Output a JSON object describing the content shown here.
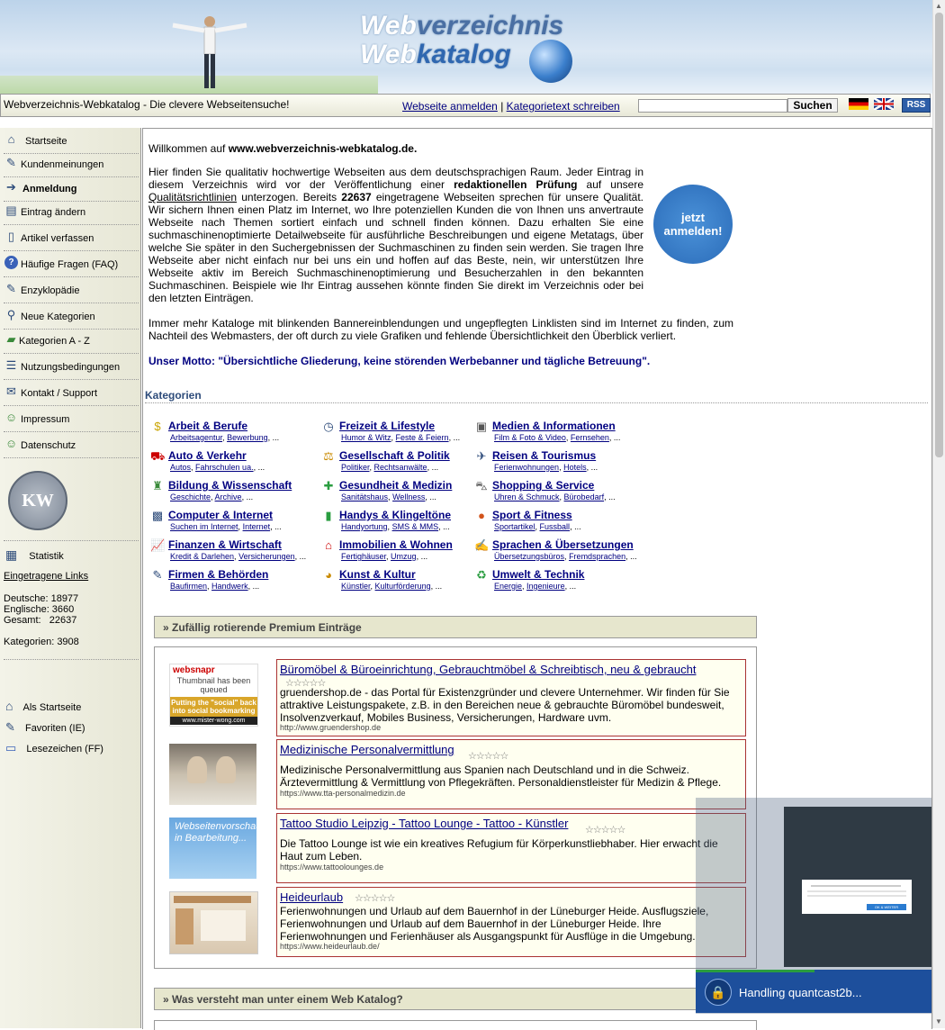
{
  "header": {
    "logo_line1_a": "Web",
    "logo_line1_b": "verzeichnis",
    "logo_line2_a": "Web",
    "logo_line2_b": "katalog"
  },
  "topbar": {
    "tagline": "Webverzeichnis-Webkatalog - Die clevere Webseitensuche!",
    "link_register": "Webseite anmelden",
    "separator": "|",
    "link_category_text": "Kategorietext schreiben",
    "search_placeholder": "",
    "search_button": "Suchen",
    "rss": "RSS"
  },
  "sidebar": {
    "items": [
      {
        "label": "Startseite",
        "icon": "home-icon"
      },
      {
        "label": "Kundenmeinungen",
        "icon": "star-note-icon"
      },
      {
        "label": "Anmeldung",
        "icon": "login-icon"
      },
      {
        "label": "Eintrag ändern",
        "icon": "edit-icon"
      },
      {
        "label": "Artikel verfassen",
        "icon": "document-icon"
      },
      {
        "label": "Häufige Fragen (FAQ)",
        "icon": "help-icon"
      },
      {
        "label": "Enzyklopädie",
        "icon": "notepad-icon"
      },
      {
        "label": "Neue Kategorien",
        "icon": "magnifier-icon"
      },
      {
        "label": "Kategorien A - Z",
        "icon": "folder-icon"
      },
      {
        "label": "Nutzungsbedingungen",
        "icon": "list-icon"
      },
      {
        "label": "Kontakt / Support",
        "icon": "mail-icon"
      },
      {
        "label": "Impressum",
        "icon": "person-icon"
      },
      {
        "label": "Datenschutz",
        "icon": "person-icon"
      }
    ],
    "statistik_label": "Statistik",
    "eingetragene_links": "Eingetragene Links",
    "stats": [
      "Deutsche: 18977",
      "Englische: 3660",
      "Gesamt:   22637",
      "Kategorien: 3908"
    ],
    "bottom": [
      {
        "label": "Als Startseite",
        "icon": "home-icon"
      },
      {
        "label": "Favoriten (IE)",
        "icon": "favorite-icon"
      },
      {
        "label": "Lesezeichen (FF)",
        "icon": "folder-icon"
      }
    ]
  },
  "main": {
    "welcome_prefix": "Willkommen auf ",
    "welcome_site": "www.webverzeichnis-webkatalog.de.",
    "intro_p1_a": "Hier finden Sie qualitativ hochwertige Webseiten aus dem deutschsprachigen Raum. Jeder Eintrag in diesem Verzeichnis wird vor der Veröffentlichung einer ",
    "intro_p1_bold": "redaktionellen Prüfung",
    "intro_p1_b": " auf unsere ",
    "intro_p1_link": "Qualitätsrichtlinien",
    "intro_p1_c": " unterzogen. Bereits ",
    "intro_p1_count": "22637",
    "intro_p1_d": " eingetragene Webseiten sprechen für unsere Qualität. Wir sichern Ihnen einen Platz im Internet, wo Ihre potenziellen Kunden die von Ihnen uns anvertraute Webseite nach Themen sortiert einfach und schnell finden können. Dazu erhalten Sie eine suchmaschinenoptimierte Detailwebseite für ausführliche Beschreibungen und eigene Metatags, über welche Sie später in den Suchergebnissen der Suchmaschinen zu finden sein werden. Sie tragen Ihre Webseite aber nicht einfach nur bei uns ein und hoffen auf das Beste, nein, wir unterstützen Ihre Webseite aktiv im Bereich Suchmaschinenoptimierung und Besucherzahlen in den bekannten Suchmaschinen. Beispiele wie Ihr Eintrag aussehen könnte finden Sie direkt im Verzeichnis oder bei den letzten Einträgen.",
    "intro_p2": "Immer mehr Kataloge mit blinkenden Bannereinblendungen und ungepflegten Linklisten sind im Internet zu finden, zum Nachteil des Webmasters, der oft durch zu viele Grafiken und fehlende Übersichtlichkeit den Überblick verliert.",
    "motto": "Unser Motto: \"Übersichtliche Gliederung, keine störenden Werbebanner und tägliche Betreuung\".",
    "signup_badge_1": "jetzt",
    "signup_badge_2": "anmelden!",
    "categories_heading": "Kategorien",
    "categories": [
      {
        "name": "Arbeit & Berufe",
        "subs": [
          "Arbeitsagentur",
          "Bewerbung"
        ],
        "icon": "money-icon"
      },
      {
        "name": "Freizeit & Lifestyle",
        "subs": [
          "Humor & Witz",
          "Feste & Feiern"
        ],
        "icon": "clock-icon"
      },
      {
        "name": "Medien & Informationen",
        "subs": [
          "Film & Foto & Video",
          "Fernsehen"
        ],
        "icon": "media-icon"
      },
      {
        "name": "Auto & Verkehr",
        "subs": [
          "Autos",
          "Fahrschulen ua."
        ],
        "icon": "car-icon"
      },
      {
        "name": "Gesellschaft & Politik",
        "subs": [
          "Politiker",
          "Rechtsanwälte"
        ],
        "icon": "scales-icon"
      },
      {
        "name": "Reisen & Tourismus",
        "subs": [
          "Ferienwohnungen",
          "Hotels"
        ],
        "icon": "airplane-icon"
      },
      {
        "name": "Bildung & Wissenschaft",
        "subs": [
          "Geschichte",
          "Archive"
        ],
        "icon": "graduation-icon"
      },
      {
        "name": "Gesundheit & Medizin",
        "subs": [
          "Sanitätshaus",
          "Wellness"
        ],
        "icon": "medical-cross-icon"
      },
      {
        "name": "Shopping & Service",
        "subs": [
          "Uhren & Schmuck",
          "Bürobedarf"
        ],
        "icon": "cart-icon"
      },
      {
        "name": "Computer & Internet",
        "subs": [
          "Suchen im Internet",
          "Internet"
        ],
        "icon": "computer-icon"
      },
      {
        "name": "Handys & Klingeltöne",
        "subs": [
          "Handyortung",
          "SMS & MMS"
        ],
        "icon": "phone-icon"
      },
      {
        "name": "Sport & Fitness",
        "subs": [
          "Sportartikel",
          "Fussball"
        ],
        "icon": "ball-icon"
      },
      {
        "name": "Finanzen & Wirtschaft",
        "subs": [
          "Kredit & Darlehen",
          "Versicherungen"
        ],
        "icon": "chart-icon"
      },
      {
        "name": "Immobilien & Wohnen",
        "subs": [
          "Fertighäuser",
          "Umzug"
        ],
        "icon": "house-icon"
      },
      {
        "name": "Sprachen & Übersetzungen",
        "subs": [
          "Übersetzungsbüros",
          "Fremdsprachen"
        ],
        "icon": "language-icon"
      },
      {
        "name": "Firmen & Behörden",
        "subs": [
          "Baufirmen",
          "Handwerk"
        ],
        "icon": "pencil-icon"
      },
      {
        "name": "Kunst & Kultur",
        "subs": [
          "Künstler",
          "Kulturförderung"
        ],
        "icon": "palette-icon"
      },
      {
        "name": "Umwelt & Technik",
        "subs": [
          "Energie",
          "Ingenieure"
        ],
        "icon": "recycle-icon"
      }
    ],
    "premium_heading": "» Zufällig rotierende Premium Einträge",
    "entries": [
      {
        "title": "Büromöbel & Büroeinrichtung, Gebrauchtmöbel & Schreibtisch, neu & gebraucht",
        "stars": "☆☆☆☆☆",
        "desc": "gruendershop.de - das Portal für Existenzgründer und clevere Unternehmer. Wir finden für Sie attraktive Leistungspakete, z.B. in den Bereichen neue & gebrauchte Büromöbel bundesweit, Insolvenzverkauf, Mobiles Business, Versicherungen, Hardware uvm.",
        "url": "http://www.gruendershop.de",
        "thumb_line1": "websnapr",
        "thumb_line2": "Thumbnail has been queued",
        "thumb_line3": "Putting the \"social\" back into social bookmarking",
        "thumb_line4": "www.mister-wong.com"
      },
      {
        "title": "Medizinische Personalvermittlung",
        "stars": "☆☆☆☆☆",
        "desc": "Medizinische Personalvermittlung aus Spanien nach Deutschland und in die Schweiz. Ärztevermittlung & Vermittlung von Pflegekräften. Personaldienstleister für Medizin & Pflege.",
        "url": "https://www.tta-personalmedizin.de"
      },
      {
        "title": "Tattoo Studio Leipzig - Tattoo Lounge - Tattoo - Künstler",
        "stars": "☆☆☆☆☆",
        "desc": "Die Tattoo Lounge ist wie ein kreatives Refugium für Körperkunstliebhaber. Hier erwacht die Haut zum Leben.",
        "url": "https://www.tattoolounges.de",
        "thumb_text": "Webseitenvorschau in Bearbeitung..."
      },
      {
        "title": "Heideurlaub",
        "stars": "☆☆☆☆☆",
        "desc": "Ferienwohnungen und Urlaub auf dem Bauernhof in der Lüneburger Heide. Ausflugsziele, Ferienwohnungen und Urlaub auf dem Bauernhof in der Lüneburger Heide. Ihre Ferienwohnungen und Ferienhäuser als Ausgangspunkt für Ausflüge in die Umgebung.",
        "url": "https://www.heideurlaub.de/"
      }
    ],
    "faq_heading": "» Was versteht man unter einem Web Katalog?"
  },
  "overlay": {
    "status_text": "Handling quantcast2b...",
    "mini_button": "OK & WEITER"
  }
}
